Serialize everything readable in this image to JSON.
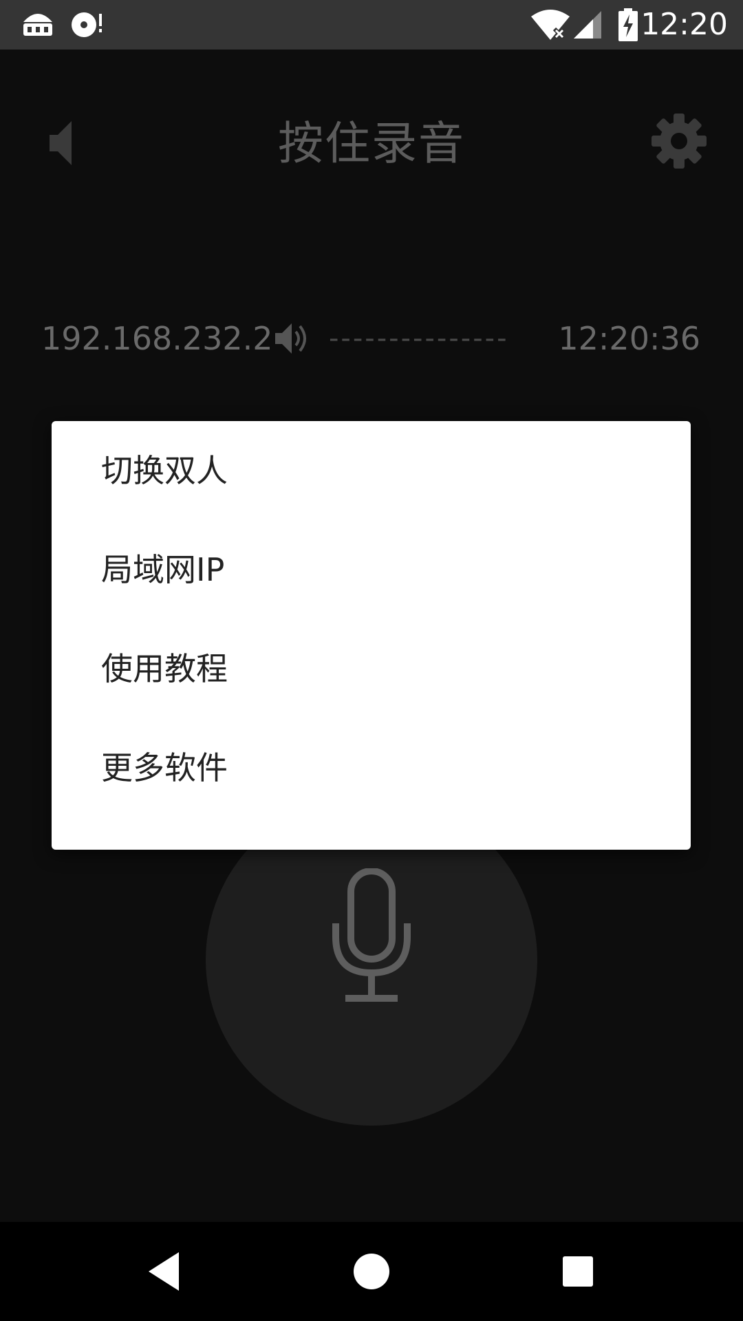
{
  "status_bar": {
    "time": "12:20",
    "left_icons": [
      "router-icon",
      "disc-alert-icon"
    ],
    "right_icons": [
      "wifi-no-internet-icon",
      "cell-signal-icon",
      "battery-charging-icon"
    ]
  },
  "app": {
    "title": "按住录音",
    "connection": {
      "ip": "192.168.232.2",
      "dashes": "---------------",
      "time": "12:20:36"
    },
    "icons": {
      "speaker": "speaker-icon",
      "settings": "gear-icon",
      "volume": "volume-icon",
      "mic": "microphone-icon"
    }
  },
  "dialog": {
    "items": [
      {
        "label": "切换双人"
      },
      {
        "label": "局域网IP"
      },
      {
        "label": "使用教程"
      },
      {
        "label": "更多软件"
      }
    ]
  },
  "nav_bar": {
    "icons": [
      "back-icon",
      "home-icon",
      "recents-icon"
    ]
  },
  "colors": {
    "background": "#0d0d0d",
    "status_bar": "#353535",
    "dialog": "#ffffff",
    "dialog_text": "#222222",
    "dim_text": "#6a6a6a"
  }
}
